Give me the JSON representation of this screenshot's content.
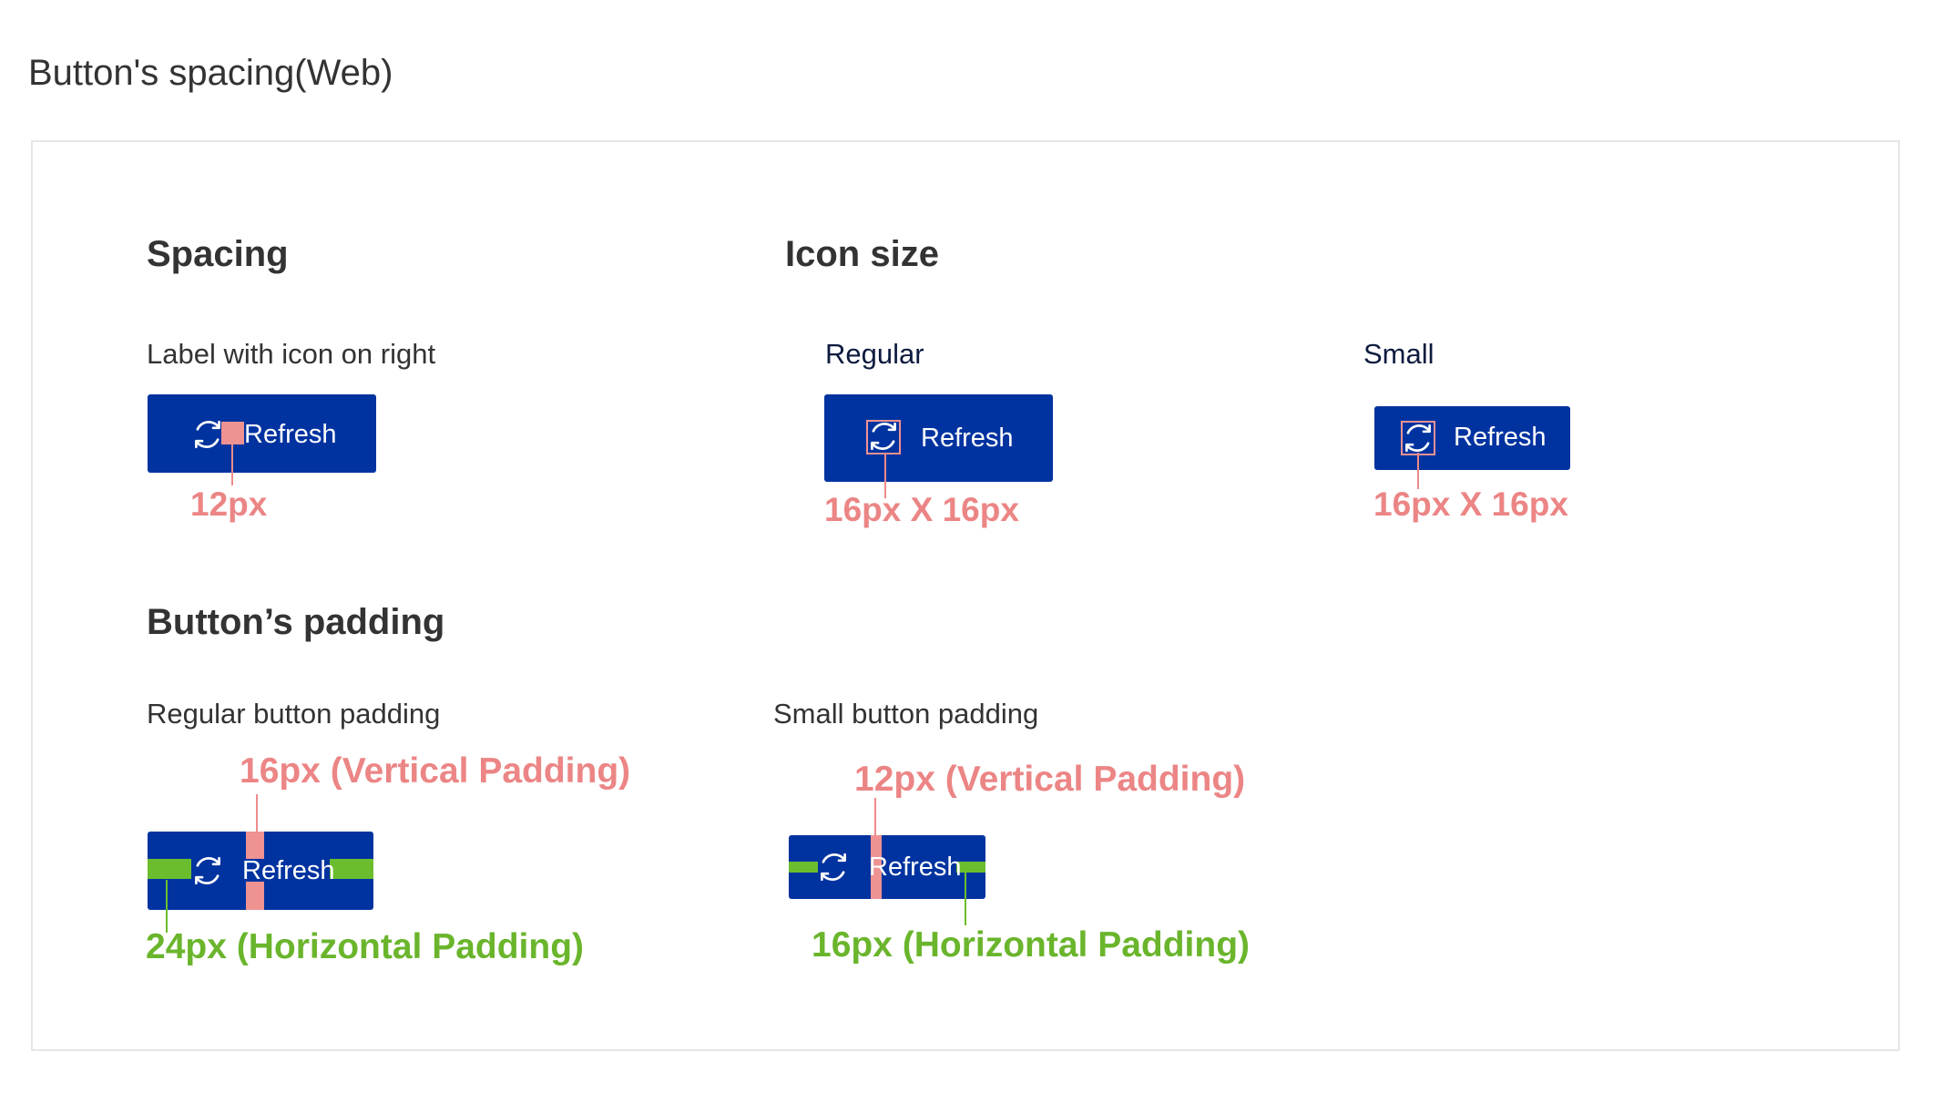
{
  "page_title": "Button's spacing(Web)",
  "spacing": {
    "title": "Spacing",
    "subtitle": "Label with icon on right",
    "button_label": "Refresh",
    "annotation": "12px"
  },
  "icon_size": {
    "title": "Icon size",
    "regular": {
      "subtitle": "Regular",
      "button_label": "Refresh",
      "annotation": "16px X 16px"
    },
    "small": {
      "subtitle": "Small",
      "button_label": "Refresh",
      "annotation": "16px X 16px"
    }
  },
  "padding": {
    "title": "Button’s padding",
    "regular": {
      "subtitle": "Regular button padding",
      "button_label": "Refresh",
      "vertical_annotation": "16px (Vertical Padding)",
      "horizontal_annotation": "24px (Horizontal Padding)"
    },
    "small": {
      "subtitle": "Small button padding",
      "button_label": "Refresh",
      "vertical_annotation": "12px (Vertical Padding)",
      "horizontal_annotation": "16px (Horizontal Padding)"
    }
  },
  "icons": {
    "button_icon": "refresh-icon"
  },
  "colors": {
    "button": "#0033a0",
    "vertical_marker": "#ee9292",
    "horizontal_marker": "#6cbd2e",
    "panel_border": "#e6e6e6"
  }
}
